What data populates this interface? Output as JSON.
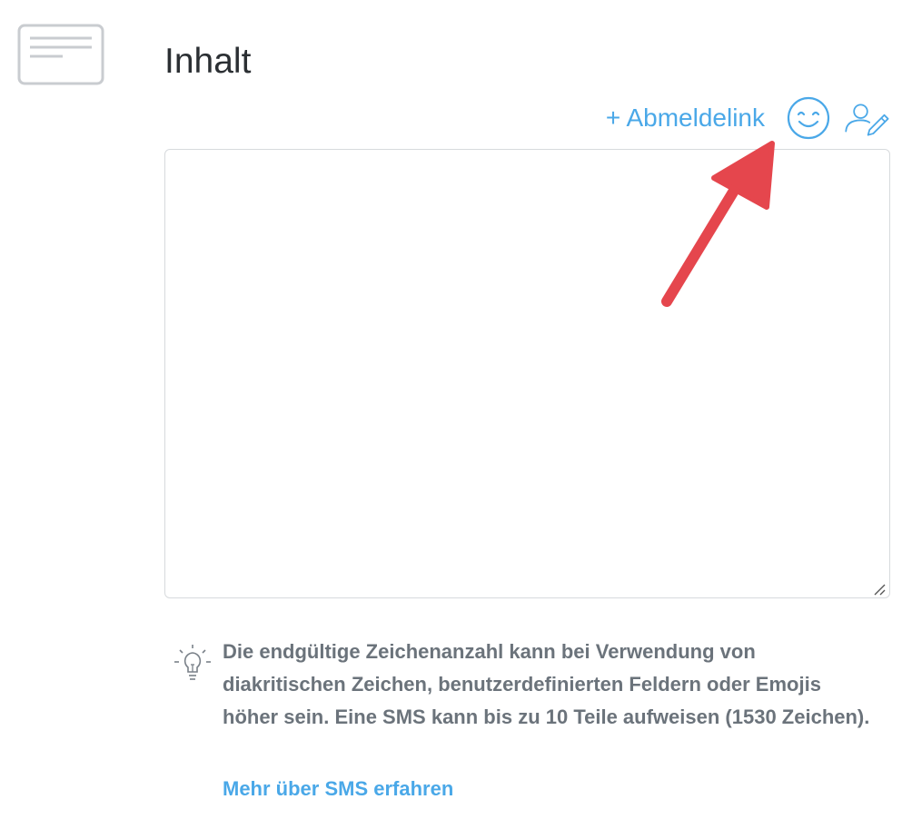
{
  "section": {
    "icon": "message-card-icon",
    "title": "Inhalt"
  },
  "toolbar": {
    "unsubscribe_link_label": "+ Abmeldelink",
    "emoji_icon": "smiley-icon",
    "personalize_icon": "user-edit-icon"
  },
  "editor": {
    "value": "",
    "placeholder": ""
  },
  "hint": {
    "icon": "lightbulb-icon",
    "text": "Die endgültige Zeichenanzahl kann bei Verwendung von diakritischen Zeichen, benutzerdefinierten Feldern oder Emojis höher sein. Eine SMS kann bis zu 10 Teile aufweisen (1530 Zeichen).",
    "link_label": "Mehr über SMS erfahren"
  },
  "annotation": {
    "arrow_color": "#e5464d"
  },
  "colors": {
    "accent": "#4aa8e8",
    "text": "#2b2f33",
    "muted": "#6b737b",
    "border": "#d7dadd"
  }
}
